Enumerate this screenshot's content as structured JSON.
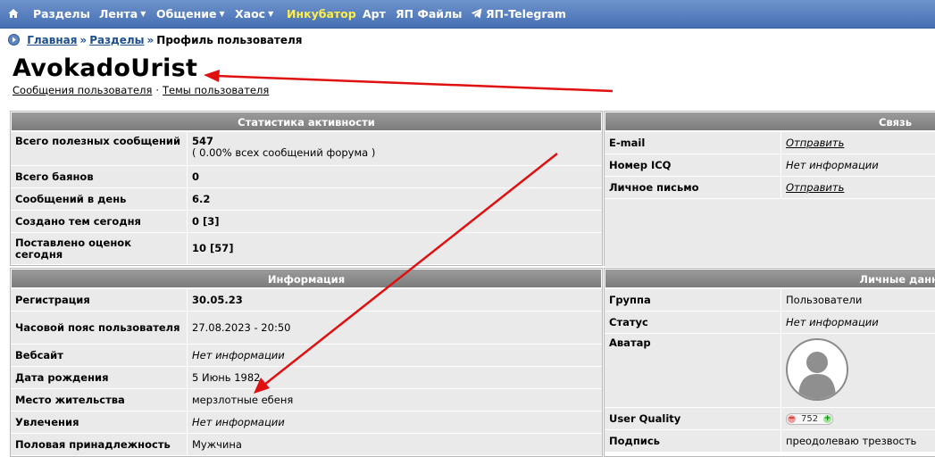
{
  "nav": {
    "items": [
      {
        "label": "Разделы",
        "dropdown": false,
        "highlight": false
      },
      {
        "label": "Лента",
        "dropdown": true,
        "highlight": false
      },
      {
        "label": "Общение",
        "dropdown": true,
        "highlight": false
      },
      {
        "label": "Хаос",
        "dropdown": true,
        "highlight": false
      },
      {
        "label": "Инкубатор",
        "dropdown": false,
        "highlight": true
      },
      {
        "label": "Арт",
        "dropdown": false,
        "highlight": false
      },
      {
        "label": "ЯП Файлы",
        "dropdown": false,
        "highlight": false
      },
      {
        "label": "ЯП-Telegram",
        "dropdown": false,
        "highlight": false
      }
    ],
    "bg_color": "#5a80c0",
    "highlight_color": "#ffef4a"
  },
  "breadcrumb": {
    "home": "Главная",
    "sections": "Разделы",
    "current": "Профиль пользователя",
    "separator": "»"
  },
  "profile": {
    "username": "AvokadoUrist",
    "link_posts": "Сообщения пользователя",
    "link_topics": "Темы пользователя",
    "link_separator": "·"
  },
  "stats": {
    "title": "Статистика активности",
    "rows": [
      {
        "label": "Всего полезных сообщений",
        "value": "547",
        "sub": "( 0.00% всех сообщений форума )"
      },
      {
        "label": "Всего баянов",
        "value": "0"
      },
      {
        "label": "Сообщений в день",
        "value": "6.2"
      },
      {
        "label": "Создано тем сегодня",
        "value": "0 [3]"
      },
      {
        "label": "Поставлено оценок сегодня",
        "value": "10 [57]"
      }
    ]
  },
  "contact": {
    "title": "Связь",
    "rows": [
      {
        "label": "E-mail",
        "value": "Отправить"
      },
      {
        "label": "Номер ICQ",
        "value": "Нет информации"
      },
      {
        "label": "Личное письмо",
        "value": "Отправить"
      }
    ]
  },
  "info": {
    "title": "Информация",
    "rows": [
      {
        "label": "Регистрация",
        "value": "30.05.23"
      },
      {
        "label": "Часовой пояс пользователя",
        "value": "27.08.2023 - 20:50"
      },
      {
        "label": "Вебсайт",
        "value": "Нет информации"
      },
      {
        "label": "Дата рождения",
        "value": "5 Июнь 1982"
      },
      {
        "label": "Место жительства",
        "value": "мерзлотные ебеня"
      },
      {
        "label": "Увлечения",
        "value": "Нет информации"
      },
      {
        "label": "Половая принадлежность",
        "value": "Мужчина"
      }
    ]
  },
  "personal": {
    "title": "Личные данн",
    "rows": [
      {
        "label": "Группа",
        "value": "Пользователи"
      },
      {
        "label": "Статус",
        "value": "Нет информации"
      },
      {
        "label": "Аватар",
        "value": ""
      },
      {
        "label": "User Quality",
        "value": "752"
      },
      {
        "label": "Подпись",
        "value": "преодолеваю трезвость"
      }
    ]
  },
  "icons": {
    "home": "home-icon",
    "telegram": "telegram-icon",
    "breadcrumb": "forum-icon",
    "avatar": "default-avatar-icon"
  },
  "annotation_color": "#e01010"
}
